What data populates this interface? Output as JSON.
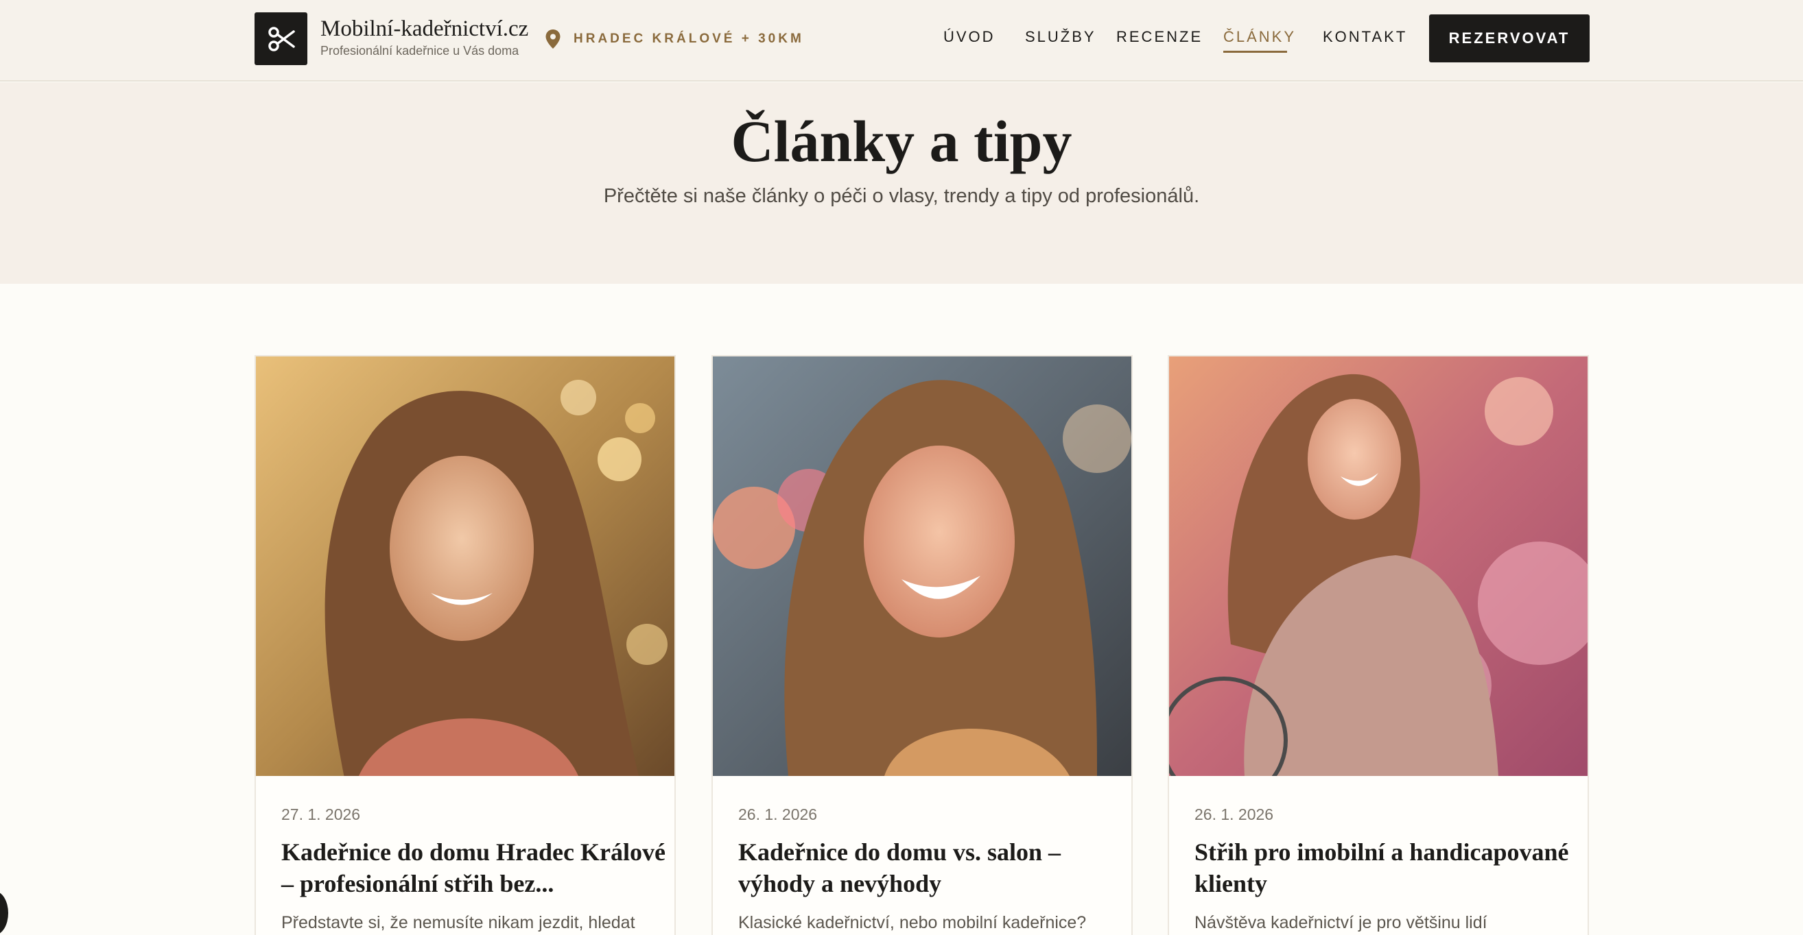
{
  "header": {
    "brand_name": "Mobilní-kadeřnictví.cz",
    "brand_tagline": "Profesionální kadeřnice u Vás doma",
    "location": "HRADEC KRÁLOVÉ + 30KM",
    "nav": [
      "ÚVOD",
      "SLUŽBY",
      "RECENZE",
      "ČLÁNKY",
      "KONTAKT"
    ],
    "active_nav": "ČLÁNKY",
    "cta_label": "REZERVOVAT"
  },
  "hero": {
    "title": "Články a tipy",
    "subtitle": "Přečtěte si naše články o péči o vlasy, trendy a tipy od profesionálů."
  },
  "articles": [
    {
      "date": "27. 1. 2026",
      "title": "Kadeřnice do domu Hradec Králové – profesionální střih bez...",
      "excerpt": "Představte si, že nemusíte nikam jezdit, hledat"
    },
    {
      "date": "26. 1. 2026",
      "title": "Kadeřnice do domu vs. salon – výhody a nevýhody",
      "excerpt": "Klasické kadeřnictví, nebo mobilní kadeřnice?"
    },
    {
      "date": "26. 1. 2026",
      "title": "Střih pro imobilní a handicapované klienty",
      "excerpt": "Návštěva kadeřnictví je pro většinu lidí"
    }
  ],
  "colors": {
    "accent": "#8a6a3c",
    "dark": "#1c1b19",
    "hero_bg": "#f5efe8",
    "header_bg": "#f6f2eb"
  },
  "icons": [
    "scissors-icon",
    "location-pin-icon"
  ]
}
